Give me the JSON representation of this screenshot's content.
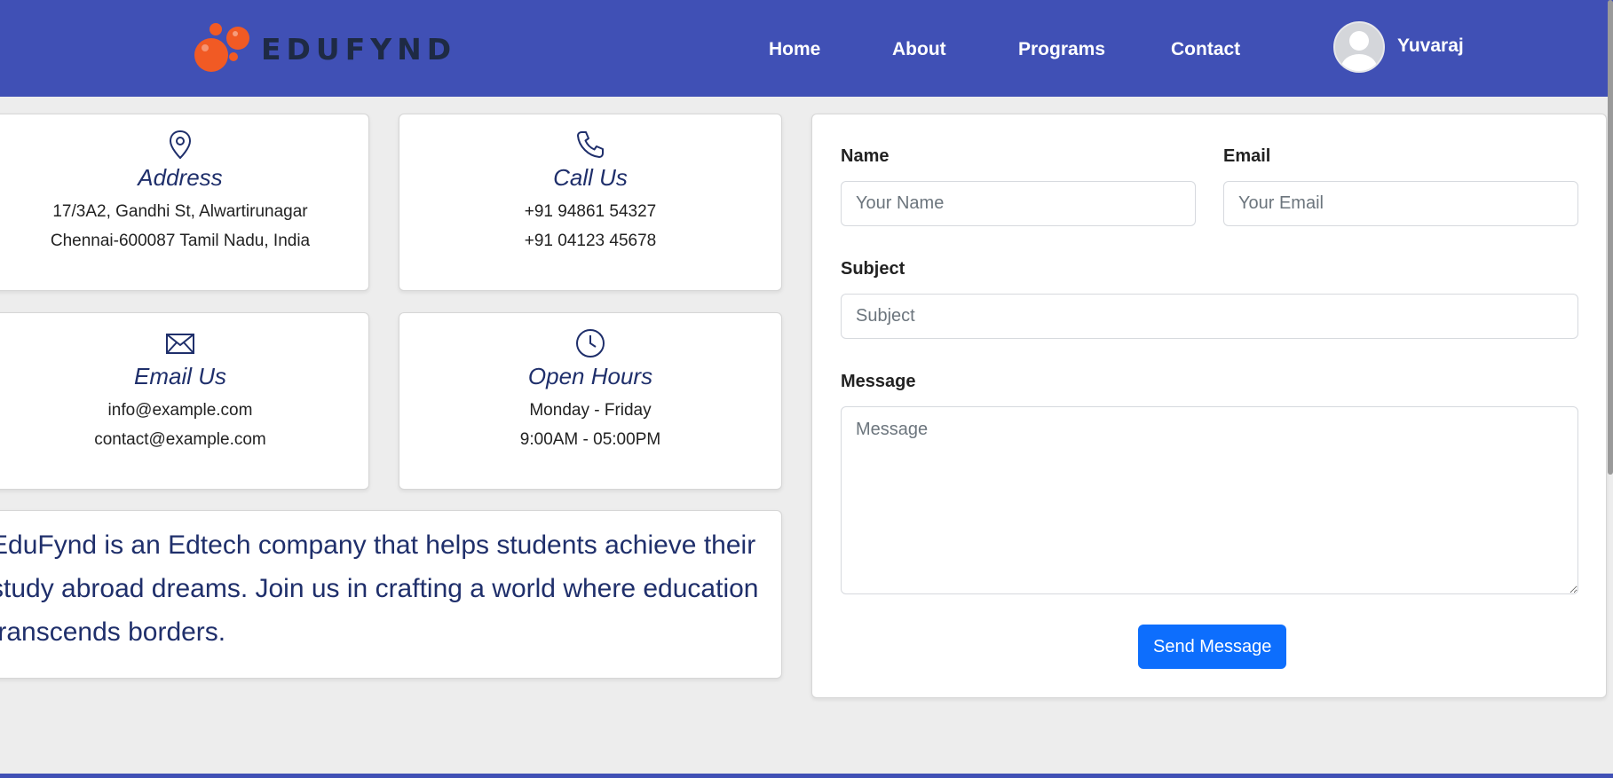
{
  "brand": {
    "name": "EDUFYND",
    "accent": "#f15a24",
    "navbar_color": "#4050b5"
  },
  "nav": {
    "items": [
      {
        "label": "Home"
      },
      {
        "label": "About"
      },
      {
        "label": "Programs"
      },
      {
        "label": "Contact"
      }
    ],
    "user": {
      "name": "Yuvaraj"
    }
  },
  "info_cards": {
    "address": {
      "title": "Address",
      "line1": "17/3A2, Gandhi St, Alwartirunagar",
      "line2": "Chennai-600087 Tamil Nadu, India",
      "icon": "map-pin-icon"
    },
    "call": {
      "title": "Call Us",
      "line1": "+91 94861 54327",
      "line2": "+91 04123 45678",
      "icon": "phone-icon"
    },
    "email": {
      "title": "Email Us",
      "line1": "info@example.com",
      "line2": "contact@example.com",
      "icon": "envelope-icon"
    },
    "hours": {
      "title": "Open Hours",
      "line1": "Monday - Friday",
      "line2": "9:00AM - 05:00PM",
      "icon": "clock-icon"
    }
  },
  "about": {
    "text": "EduFynd is an Edtech company that helps students achieve their study abroad dreams. Join us in crafting a world where education transcends borders."
  },
  "form": {
    "name_label": "Name",
    "name_placeholder": "Your Name",
    "name_value": "",
    "email_label": "Email",
    "email_placeholder": "Your Email",
    "email_value": "",
    "subject_label": "Subject",
    "subject_placeholder": "Subject",
    "subject_value": "",
    "message_label": "Message",
    "message_placeholder": "Message",
    "message_value": "",
    "submit_label": "Send Message",
    "submit_color": "#0d6efd"
  }
}
